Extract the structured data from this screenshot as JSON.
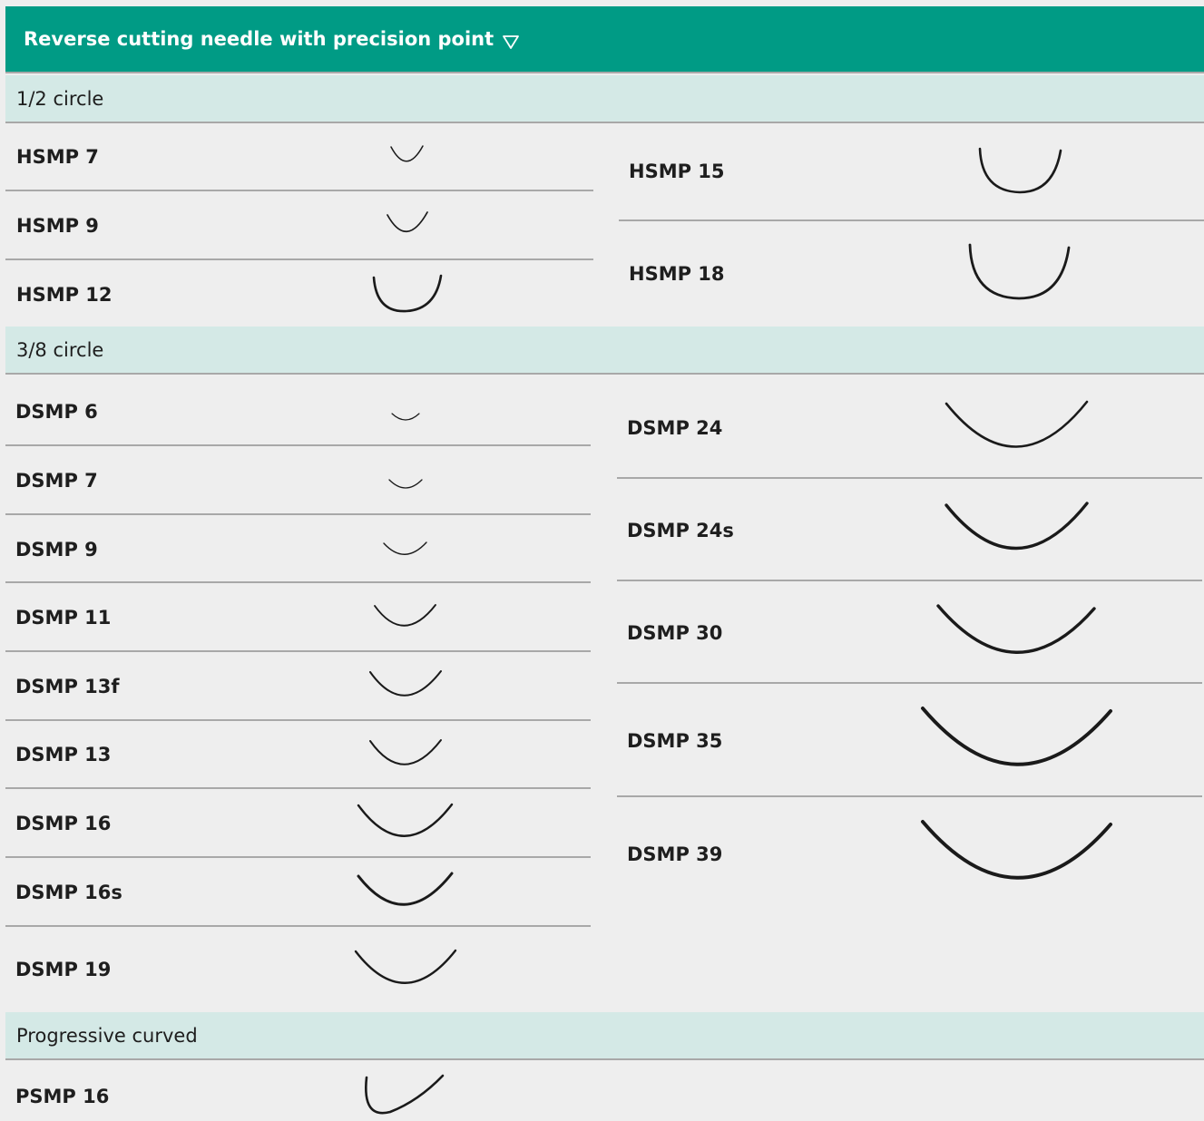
{
  "header": {
    "title": "Reverse cutting needle with precision point",
    "dropdown_icon": "triangle-down-icon"
  },
  "sections": {
    "half_circle": "1/2 circle",
    "three_eighth_circle": "3/8 circle",
    "progressive_curved": "Progressive curved"
  },
  "needles": {
    "hsmp7": "HSMP 7",
    "hsmp9": "HSMP 9",
    "hsmp12": "HSMP 12",
    "hsmp15": "HSMP 15",
    "hsmp18": "HSMP 18",
    "dsmp6": "DSMP 6",
    "dsmp7": "DSMP 7",
    "dsmp9": "DSMP 9",
    "dsmp11": "DSMP 11",
    "dsmp13f": "DSMP 13f",
    "dsmp13": "DSMP 13",
    "dsmp16": "DSMP 16",
    "dsmp16s": "DSMP 16s",
    "dsmp19": "DSMP 19",
    "dsmp24": "DSMP 24",
    "dsmp24s": "DSMP 24s",
    "dsmp30": "DSMP 30",
    "dsmp35": "DSMP 35",
    "dsmp39": "DSMP 39",
    "psmp16": "PSMP 16"
  },
  "colors": {
    "header_bg": "#009b85",
    "section_bg": "#d4e9e6",
    "page_bg": "#eeeeee",
    "divider": "#a8a8a8"
  }
}
